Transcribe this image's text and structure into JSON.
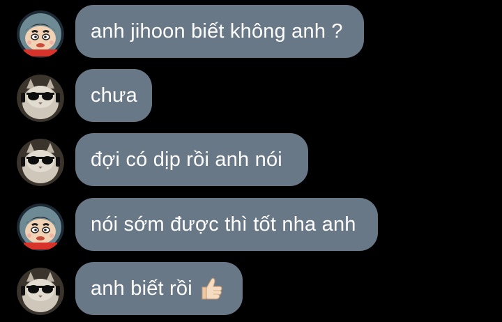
{
  "theme": {
    "background": "#000000",
    "bubble_color": "#687886",
    "bubble_text_color": "#ffffff"
  },
  "messages": [
    {
      "sender": "shin",
      "avatar_icon": "shin-chan-avatar-icon",
      "text": "anh jihoon biết không anh ?"
    },
    {
      "sender": "cat",
      "avatar_icon": "cat-sunglasses-avatar-icon",
      "text": "chưa"
    },
    {
      "sender": "cat",
      "avatar_icon": "cat-sunglasses-avatar-icon",
      "text": "đợi có dịp rồi anh nói"
    },
    {
      "sender": "shin",
      "avatar_icon": "shin-chan-avatar-icon",
      "text": "nói sớm được thì tốt nha anh"
    },
    {
      "sender": "cat",
      "avatar_icon": "cat-sunglasses-avatar-icon",
      "text": "anh biết rồi",
      "emoji": "thumbs-up-icon"
    }
  ]
}
